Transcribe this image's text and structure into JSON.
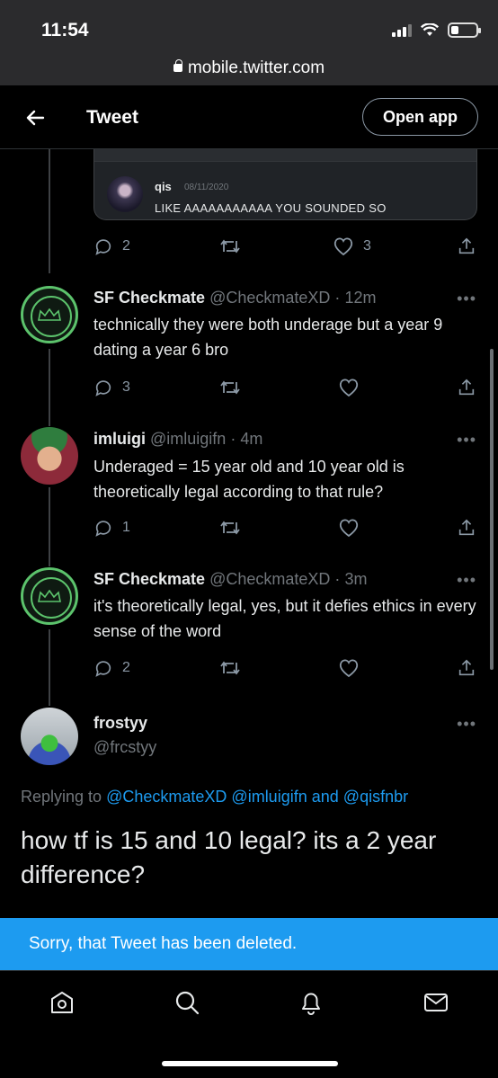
{
  "status_bar": {
    "time": "11:54",
    "url": "mobile.twitter.com"
  },
  "header": {
    "title": "Tweet",
    "open_app": "Open app"
  },
  "quoted": {
    "name": "qis",
    "date": "08/11/2020",
    "text": "LIKE AAAAAAAAAAA YOU SOUNDED SO",
    "reply_count": "2",
    "like_count": "3"
  },
  "tweets": [
    {
      "name": "SF Checkmate",
      "handle": "@CheckmateXD",
      "time": "12m",
      "text": "technically they were both underage but a year 9 dating a year 6 bro",
      "reply_count": "3"
    },
    {
      "name": "imluigi",
      "handle": "@imluigifn",
      "time": "4m",
      "text": "Underaged = 15 year old and 10 year old is theoretically legal according to that rule?",
      "reply_count": "1"
    },
    {
      "name": "SF Checkmate",
      "handle": "@CheckmateXD",
      "time": "3m",
      "text": "it's theoretically legal, yes, but it defies ethics in every sense of the word",
      "reply_count": "2"
    }
  ],
  "main_tweet": {
    "name": "frostyy",
    "handle": "@frcstyy",
    "replying_prefix": "Replying to",
    "mention_1": "@CheckmateXD",
    "mention_2": "@imluigifn",
    "and_word": "and",
    "mention_3": "@qisfnbr",
    "text": "how tf is 15 and 10 legal? its a 2 year difference?"
  },
  "toast": {
    "text": "Sorry, that Tweet has been deleted."
  },
  "separator": "·",
  "more_glyph": "•••"
}
